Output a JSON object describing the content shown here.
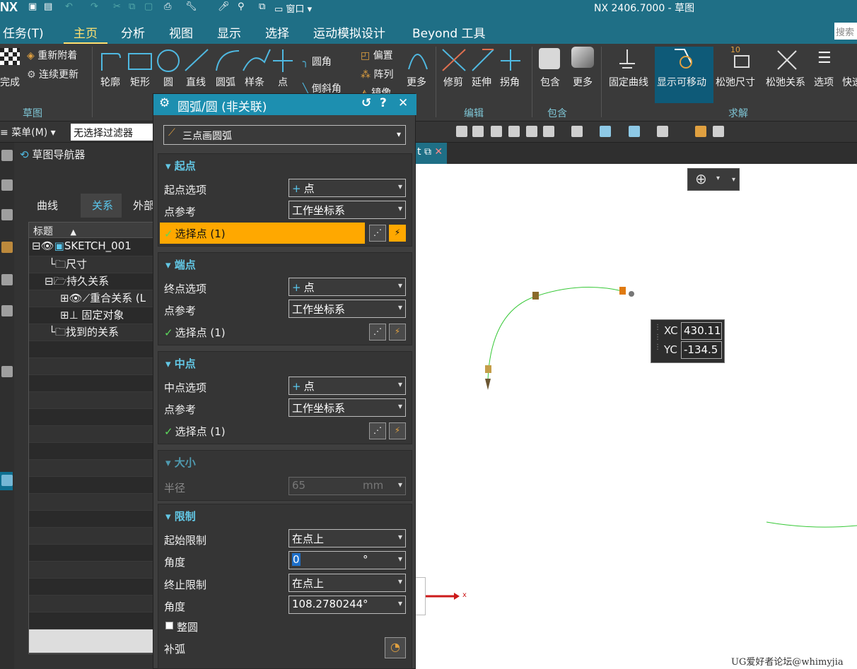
{
  "title_bar": {
    "logo": "NX",
    "window_menu": "窗口",
    "title": "NX 2406.7000 - 草图"
  },
  "menu_tabs": [
    "任务(T)",
    "主页",
    "分析",
    "视图",
    "显示",
    "选择",
    "运动模拟设计",
    "Beyond 工具"
  ],
  "search_placeholder": "搜索",
  "ribbon": {
    "finish": "完成",
    "reattach": "重新附着",
    "continuous_update": "连续更新",
    "group_sketch": "草图",
    "profile": "轮廓",
    "rectangle": "矩形",
    "circle": "圆",
    "line": "直线",
    "arc": "圆弧",
    "spline": "样条",
    "point": "点",
    "fillet": "圆角",
    "chamfer": "倒斜角",
    "offset": "偏置",
    "array": "阵列",
    "mirror": "镜像",
    "more1": "更多",
    "trim": "修剪",
    "extend": "延伸",
    "corner": "拐角",
    "group_edit": "编辑",
    "include": "包含",
    "more2": "更多",
    "group_include": "包含",
    "fix_curve": "固定曲线",
    "show_movable": "显示可移动",
    "relax_dim": "松弛尺寸",
    "relax_rel": "松弛关系",
    "options": "选项",
    "quick": "快速",
    "group_solve": "求解",
    "dim_value": "10"
  },
  "toolbar2": {
    "menu": "菜单(M)",
    "filter": "无选择过滤器"
  },
  "navigator": {
    "title": "草图导航器",
    "tabs": [
      "曲线",
      "关系",
      "外部引"
    ],
    "column": "标题",
    "rows": [
      "SKETCH_001",
      "尺寸",
      "持久关系",
      "重合关系 (L",
      "固定对象",
      "找到的关系"
    ]
  },
  "graphics": {
    "tab_label": "t",
    "xc_label": "XC",
    "xc_value": "430.11",
    "yc_label": "YC",
    "yc_value": "-134.5",
    "axis_x": "x",
    "watermark": "UG爱好者论坛@whimyjia"
  },
  "dialog": {
    "title": "圆弧/圆 (非关联)",
    "reset": "↺",
    "help": "?",
    "close": "✕",
    "type": "三点画圆弧",
    "start": {
      "header": "起点",
      "option_label": "起点选项",
      "option_value": "点",
      "ref_label": "点参考",
      "ref_value": "工作坐标系",
      "select": "选择点 (1)"
    },
    "end": {
      "header": "端点",
      "option_label": "终点选项",
      "option_value": "点",
      "ref_label": "点参考",
      "ref_value": "工作坐标系",
      "select": "选择点 (1)"
    },
    "mid": {
      "header": "中点",
      "option_label": "中点选项",
      "option_value": "点",
      "ref_label": "点参考",
      "ref_value": "工作坐标系",
      "select": "选择点 (1)"
    },
    "size": {
      "header": "大小",
      "radius_label": "半径",
      "radius_value": "65",
      "radius_unit": "mm"
    },
    "limits": {
      "header": "限制",
      "start_limit_label": "起始限制",
      "start_limit_value": "在点上",
      "angle1_label": "角度",
      "angle1_value": "0",
      "deg": "°",
      "end_limit_label": "终止限制",
      "end_limit_value": "在点上",
      "angle2_label": "角度",
      "angle2_value": "108.2780244",
      "full_circle": "整圆",
      "complement": "补弧"
    }
  }
}
